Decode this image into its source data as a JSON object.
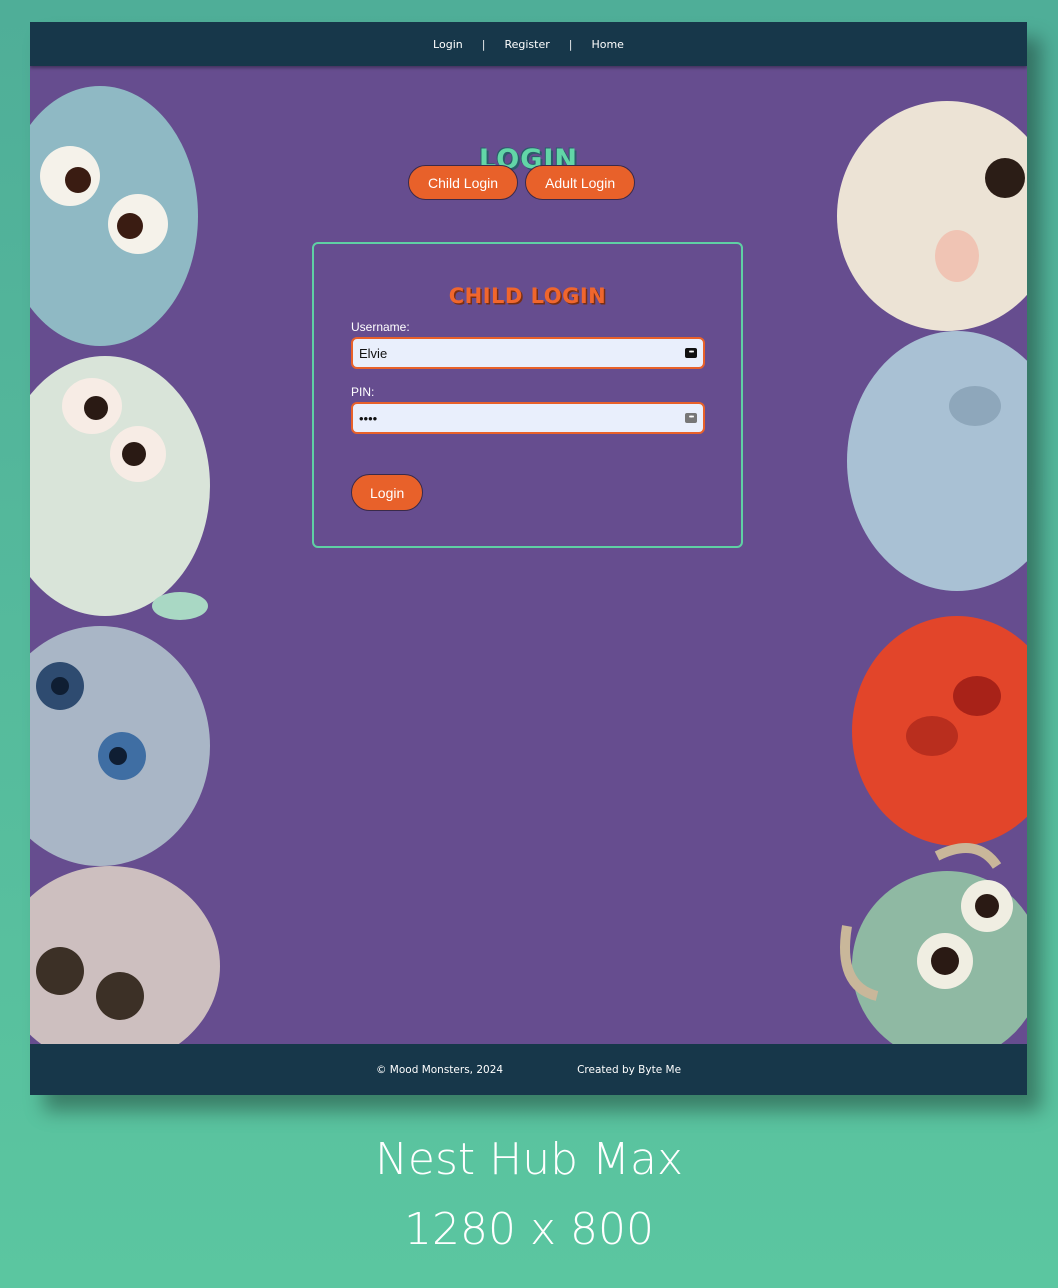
{
  "nav": {
    "items": [
      {
        "label": "Login"
      },
      {
        "label": "Register"
      },
      {
        "label": "Home"
      }
    ],
    "separator": "|"
  },
  "page": {
    "title": "LOGIN"
  },
  "tabs": {
    "child_label": "Child Login",
    "adult_label": "Adult Login"
  },
  "form": {
    "title": "CHILD LOGIN",
    "username_label": "Username:",
    "username_value": "Elvie",
    "pin_label": "PIN:",
    "pin_value": "••••",
    "submit_label": "Login"
  },
  "footer": {
    "copyright": "© Mood Monsters, 2024",
    "credit": "Created by Byte Me"
  },
  "caption": {
    "device": "Nest Hub Max",
    "resolution": "1280 x 800"
  },
  "colors": {
    "nav_bg": "#17374a",
    "page_bg": "#664d8f",
    "accent_orange": "#e8612a",
    "accent_mint": "#5fd0a4",
    "outer_bg": "#55ba9c"
  },
  "decorations": {
    "left_monsters": [
      "blue-spiky-monster",
      "white-furry-monster",
      "grey-blue-monster",
      "pink-fluffy-monster"
    ],
    "right_monsters": [
      "cream-fluffy-monster",
      "pale-blue-grumpy-monster",
      "red-furry-angry-monster",
      "green-horned-monster"
    ]
  }
}
